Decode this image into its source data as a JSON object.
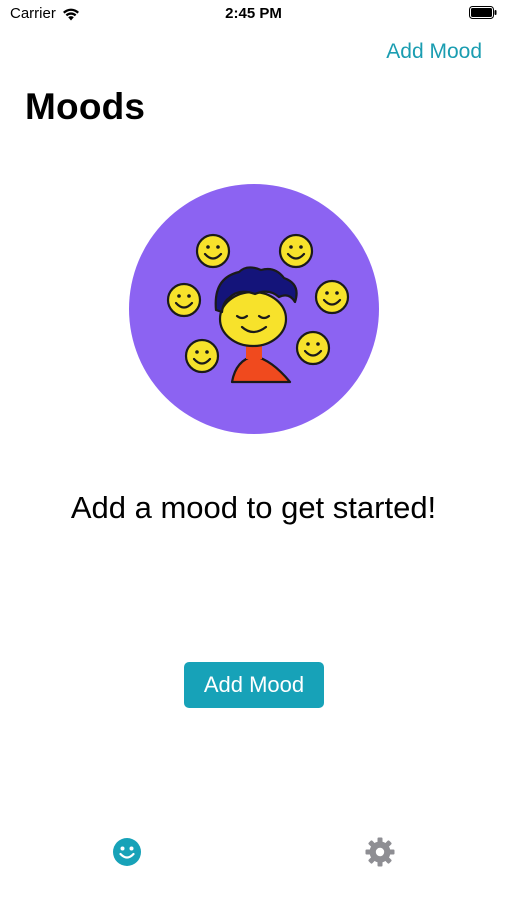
{
  "status_bar": {
    "carrier": "Carrier",
    "time": "2:45 PM",
    "wifi_icon": "wifi-icon",
    "battery_icon": "battery-icon"
  },
  "header": {
    "action_label": "Add Mood",
    "title": "Moods"
  },
  "main": {
    "illustration": "moods-illustration",
    "empty_message": "Add a mood to get started!",
    "add_button_label": "Add Mood"
  },
  "tab_bar": {
    "tabs": [
      {
        "icon": "smiley-icon",
        "active": true
      },
      {
        "icon": "gear-icon",
        "active": false
      }
    ]
  },
  "colors": {
    "accent": "#17a2b8",
    "illustration_bg": "#8c63f2",
    "smiley_yellow": "#f7e22b",
    "hair": "#14147a",
    "shirt": "#f04a1e",
    "inactive_tab": "#8e8e93"
  }
}
